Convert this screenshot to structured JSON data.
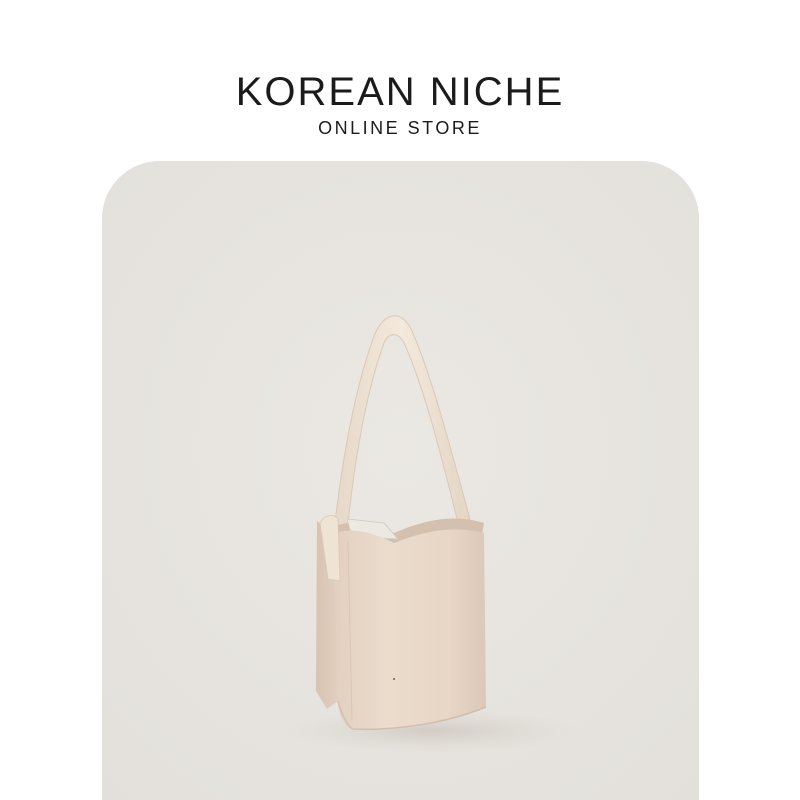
{
  "brand": {
    "title": "KOREAN NICHE",
    "subtitle": "ONLINE STORE"
  },
  "product": {
    "image_subject": "bucket-bag",
    "colors": {
      "background": "#e7e4df",
      "bag_body": "#e9d8c9",
      "strap": "#efe3d4"
    }
  }
}
